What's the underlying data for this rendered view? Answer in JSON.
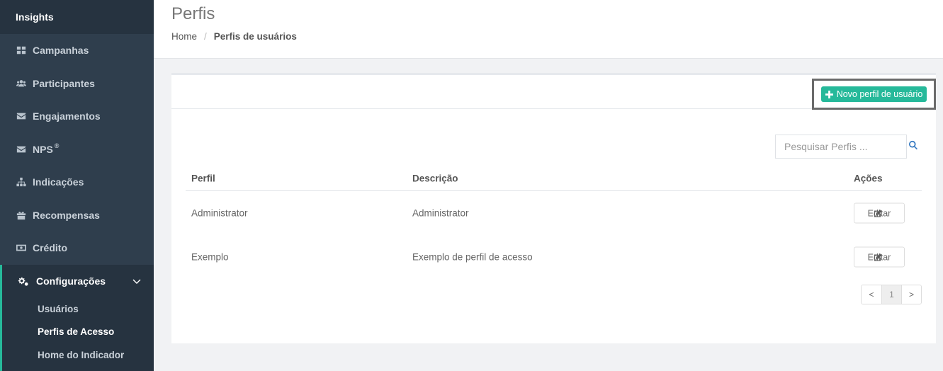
{
  "sidebar": {
    "top": {
      "label": "Insights",
      "icon": "lightbulb-icon"
    },
    "items": [
      {
        "label": "Campanhas",
        "icon": "grid-icon"
      },
      {
        "label": "Participantes",
        "icon": "users-icon"
      },
      {
        "label": "Engajamentos",
        "icon": "envelope-icon"
      },
      {
        "label": "NPS",
        "sup": "®",
        "icon": "envelope-icon"
      },
      {
        "label": "Indicações",
        "icon": "sitemap-icon"
      },
      {
        "label": "Recompensas",
        "icon": "gift-icon"
      },
      {
        "label": "Crédito",
        "icon": "money-icon"
      }
    ],
    "config": {
      "label": "Configurações",
      "icon": "cogs-icon",
      "sub": [
        {
          "label": "Usuários"
        },
        {
          "label": "Perfis de Acesso"
        },
        {
          "label": "Home do Indicador"
        }
      ]
    }
  },
  "header": {
    "title": "Perfis",
    "breadcrumb": {
      "home": "Home",
      "sep": "/",
      "current": "Perfis de usuários"
    }
  },
  "panel": {
    "new_button": "Novo perfil de usuário",
    "search_placeholder": "Pesquisar Perfis ...",
    "columns": {
      "perfil": "Perfil",
      "descricao": "Descrição",
      "acoes": "Ações"
    },
    "rows": [
      {
        "perfil": "Administrator",
        "descricao": "Administrator",
        "action": "Editar"
      },
      {
        "perfil": "Exemplo",
        "descricao": "Exemplo de perfil de acesso",
        "action": "Editar"
      }
    ],
    "pagination": {
      "prev": "<",
      "page": "1",
      "next": ">"
    }
  },
  "colors": {
    "sidebar": "#2f3e4d",
    "accent": "#26b99a",
    "link": "#3a7cc2"
  }
}
